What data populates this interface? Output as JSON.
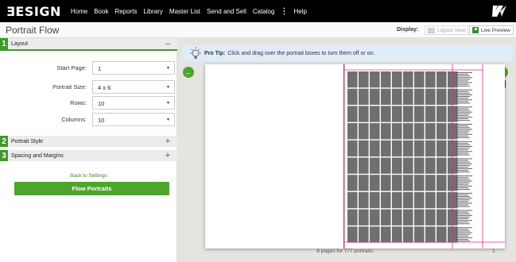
{
  "app": {
    "logo": "ƎESIGN",
    "nav": [
      "Home",
      "Book",
      "Reports",
      "Library",
      "Master List",
      "Send and Sell",
      "Catalog",
      "Help"
    ],
    "nav_separator": "⋮"
  },
  "header": {
    "title": "Portrait Flow",
    "display_label": "Display:",
    "layout_view_label": "Layout View",
    "live_preview_label": "Live Preview"
  },
  "sidebar": {
    "sections": [
      {
        "num": "1",
        "label": "Layout",
        "toggle": "–"
      },
      {
        "num": "2",
        "label": "Portrait Style",
        "toggle": "+"
      },
      {
        "num": "3",
        "label": "Spacing and Margins",
        "toggle": "+"
      }
    ],
    "fields": [
      {
        "label": "Start Page:",
        "value": "1"
      },
      {
        "label": "Portrait Size:",
        "value": "4 x 6"
      },
      {
        "label": "Rows:",
        "value": "10"
      },
      {
        "label": "Columns:",
        "value": "10"
      }
    ],
    "back_link": "Back to Settings",
    "flow_button": "Flow Portraits"
  },
  "main": {
    "tip_bold": "Pro Tip:",
    "tip_text": "Click and drag over the portrait boxes to turn them off or on.",
    "footer": "8 pages for 777 portraits.",
    "page_number": "1",
    "grid_rows": 10,
    "grid_columns": 10
  },
  "colors": {
    "accent_green": "#4ea52d",
    "guide_magenta": "#d6339a",
    "portrait_gray": "#6f6f6f"
  }
}
